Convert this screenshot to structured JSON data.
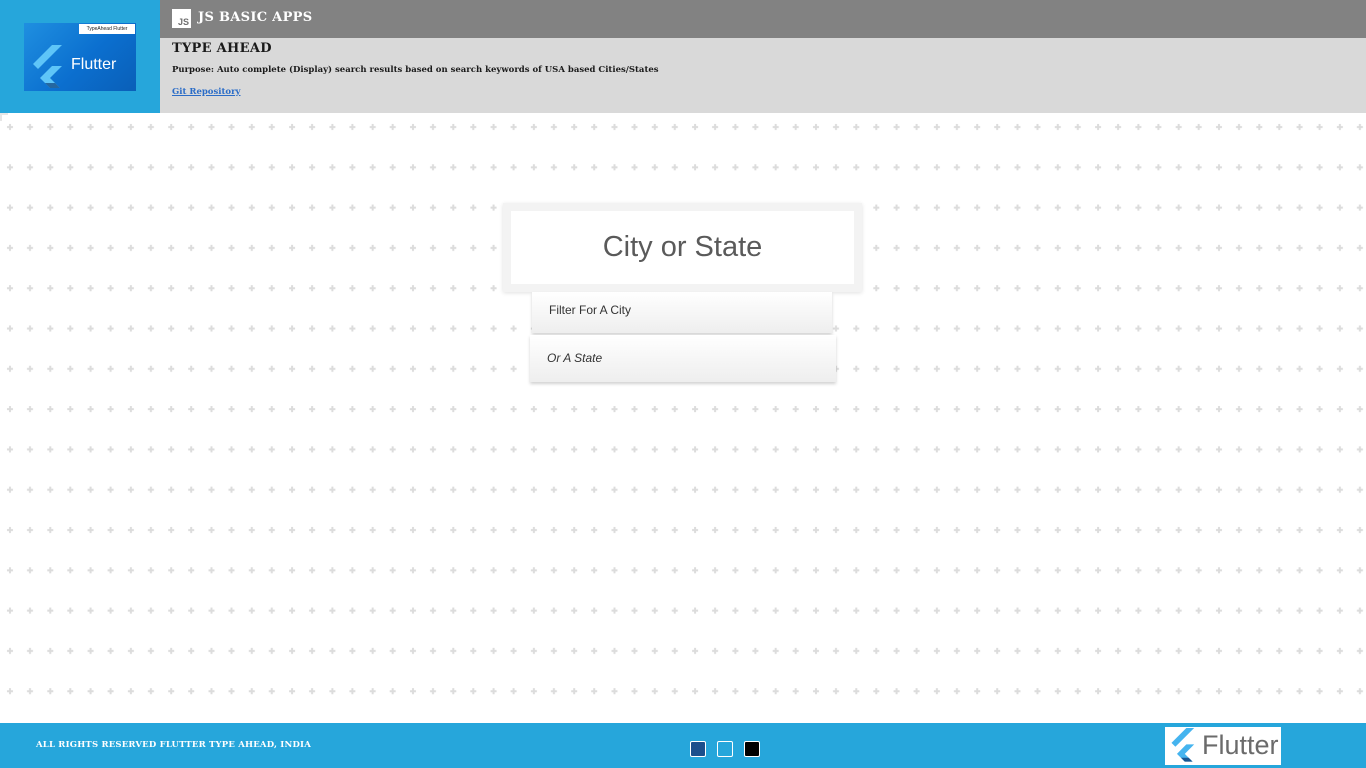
{
  "header": {
    "logo_caption": "TypeAhead Flutter",
    "logo_word": "Flutter",
    "badge": "JS",
    "app_title": "JS BASIC APPS",
    "page_title": "TYPE AHEAD",
    "purpose": "Purpose: Auto complete (Display) search results based on search keywords of USA based Cities/States",
    "repo_link": "Git Repository"
  },
  "search": {
    "placeholder": "City or State",
    "value": "",
    "suggestions": [
      "Filter For A City",
      "Or A State"
    ]
  },
  "footer": {
    "copyright": "ALL RIGHTS RESERVED FLUTTER TYPE AHEAD, INDIA",
    "logo_word": "Flutter",
    "theme_swatches": [
      {
        "name": "dark-blue",
        "color": "#1c4f8c"
      },
      {
        "name": "light-blue",
        "color": "#26a6db"
      },
      {
        "name": "black",
        "color": "#000000"
      }
    ]
  },
  "colors": {
    "accent": "#26a6db",
    "title_bar": "#828282",
    "info_bar": "#d9d9d9",
    "link": "#2a6cc7"
  }
}
